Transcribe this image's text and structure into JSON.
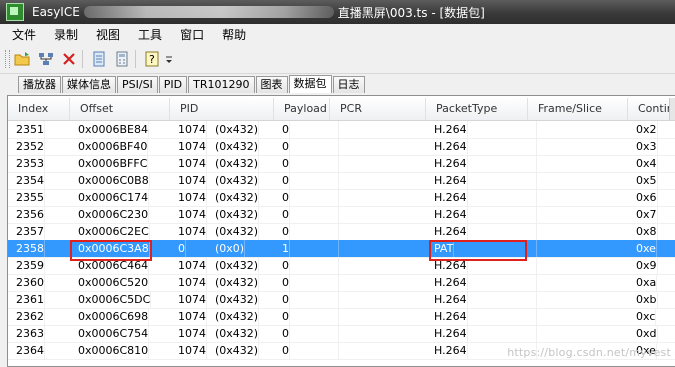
{
  "window": {
    "app_name": "EasyICE",
    "file_title": "直播黑屏\\003.ts - [数据包]"
  },
  "menu": [
    "文件",
    "录制",
    "视图",
    "工具",
    "窗口",
    "帮助"
  ],
  "toolbar": {
    "icons": [
      "open-folder-icon",
      "network-icon",
      "close-x-icon",
      "copy-doc-icon",
      "calculator-icon",
      "help-icon"
    ]
  },
  "tabs": [
    {
      "label": "播放器",
      "active": false
    },
    {
      "label": "媒体信息",
      "active": false
    },
    {
      "label": "PSI/SI",
      "active": false
    },
    {
      "label": "PID",
      "active": false
    },
    {
      "label": "TR101290",
      "active": false
    },
    {
      "label": "图表",
      "active": false
    },
    {
      "label": "数据包",
      "active": true
    },
    {
      "label": "日志",
      "active": false
    }
  ],
  "table": {
    "columns": [
      "Index",
      "Offset",
      "PID",
      "Payload",
      "PCR",
      "PacketType",
      "Frame/Slice",
      "Continu"
    ],
    "selected_index": "2358",
    "rows": [
      {
        "index": "2351",
        "offset": "0x0006BE84",
        "pid": "1074",
        "pid_hex": "(0x432)",
        "payload": "0",
        "pcr": "",
        "type": "H.264",
        "frame": "",
        "cc": "0x2"
      },
      {
        "index": "2352",
        "offset": "0x0006BF40",
        "pid": "1074",
        "pid_hex": "(0x432)",
        "payload": "0",
        "pcr": "",
        "type": "H.264",
        "frame": "",
        "cc": "0x3"
      },
      {
        "index": "2353",
        "offset": "0x0006BFFC",
        "pid": "1074",
        "pid_hex": "(0x432)",
        "payload": "0",
        "pcr": "",
        "type": "H.264",
        "frame": "",
        "cc": "0x4"
      },
      {
        "index": "2354",
        "offset": "0x0006C0B8",
        "pid": "1074",
        "pid_hex": "(0x432)",
        "payload": "0",
        "pcr": "",
        "type": "H.264",
        "frame": "",
        "cc": "0x5"
      },
      {
        "index": "2355",
        "offset": "0x0006C174",
        "pid": "1074",
        "pid_hex": "(0x432)",
        "payload": "0",
        "pcr": "",
        "type": "H.264",
        "frame": "",
        "cc": "0x6"
      },
      {
        "index": "2356",
        "offset": "0x0006C230",
        "pid": "1074",
        "pid_hex": "(0x432)",
        "payload": "0",
        "pcr": "",
        "type": "H.264",
        "frame": "",
        "cc": "0x7"
      },
      {
        "index": "2357",
        "offset": "0x0006C2EC",
        "pid": "1074",
        "pid_hex": "(0x432)",
        "payload": "0",
        "pcr": "",
        "type": "H.264",
        "frame": "",
        "cc": "0x8"
      },
      {
        "index": "2358",
        "offset": "0x0006C3A8",
        "pid": "0",
        "pid_hex": "(0x0)",
        "payload": "1",
        "pcr": "",
        "type": "PAT",
        "frame": "",
        "cc": "0xe"
      },
      {
        "index": "2359",
        "offset": "0x0006C464",
        "pid": "1074",
        "pid_hex": "(0x432)",
        "payload": "0",
        "pcr": "",
        "type": "H.264",
        "frame": "",
        "cc": "0x9"
      },
      {
        "index": "2360",
        "offset": "0x0006C520",
        "pid": "1074",
        "pid_hex": "(0x432)",
        "payload": "0",
        "pcr": "",
        "type": "H.264",
        "frame": "",
        "cc": "0xa"
      },
      {
        "index": "2361",
        "offset": "0x0006C5DC",
        "pid": "1074",
        "pid_hex": "(0x432)",
        "payload": "0",
        "pcr": "",
        "type": "H.264",
        "frame": "",
        "cc": "0xb"
      },
      {
        "index": "2362",
        "offset": "0x0006C698",
        "pid": "1074",
        "pid_hex": "(0x432)",
        "payload": "0",
        "pcr": "",
        "type": "H.264",
        "frame": "",
        "cc": "0xc"
      },
      {
        "index": "2363",
        "offset": "0x0006C754",
        "pid": "1074",
        "pid_hex": "(0x432)",
        "payload": "0",
        "pcr": "",
        "type": "H.264",
        "frame": "",
        "cc": "0xd"
      },
      {
        "index": "2364",
        "offset": "0x0006C810",
        "pid": "1074",
        "pid_hex": "(0x432)",
        "payload": "0",
        "pcr": "",
        "type": "H.264",
        "frame": "",
        "cc": "0xe"
      }
    ]
  },
  "watermark": "https://blog.csdn.net/myvest",
  "colors": {
    "selection": "#3399ff",
    "annotation_box": "#e0201c"
  }
}
